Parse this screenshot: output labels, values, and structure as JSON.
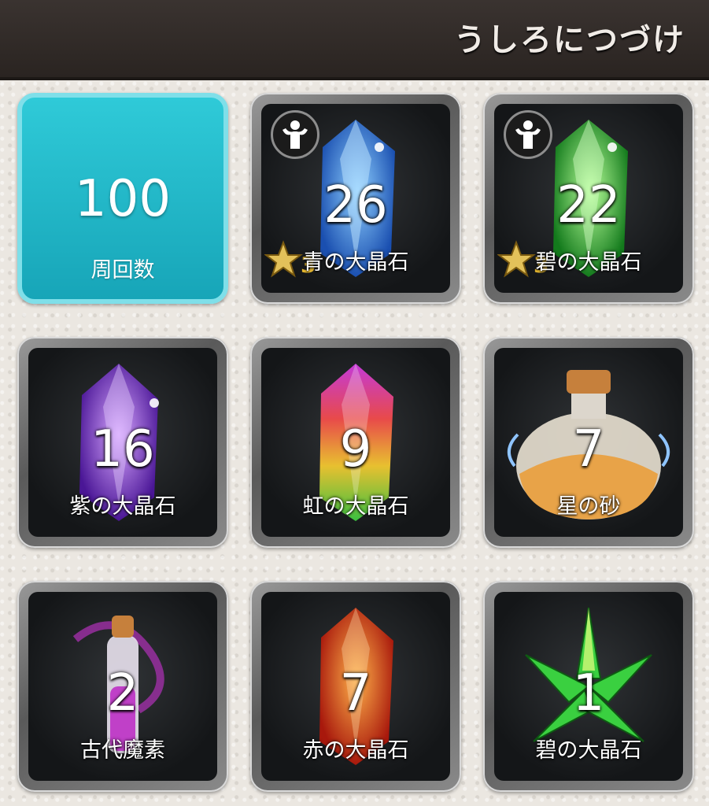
{
  "header": {
    "title": "うしろにつづけ"
  },
  "summary": {
    "count": "100",
    "label": "周回数"
  },
  "items": [
    {
      "count": "26",
      "label": "青の大晶石",
      "icon": "blue-crystal-icon",
      "color": "#2f7ad8",
      "strength_badge": true,
      "star_rank": "3"
    },
    {
      "count": "22",
      "label": "碧の大晶石",
      "icon": "green-crystal-icon",
      "color": "#2fbf3a",
      "strength_badge": true,
      "star_rank": "3"
    },
    {
      "count": "16",
      "label": "紫の大晶石",
      "icon": "purple-crystal-icon",
      "color": "#8a3ad8"
    },
    {
      "count": "9",
      "label": "虹の大晶石",
      "icon": "rainbow-crystal-icon",
      "color": "#d84ab0"
    },
    {
      "count": "7",
      "label": "星の砂",
      "icon": "star-sand-bottle-icon",
      "color": "#e0a050"
    },
    {
      "count": "2",
      "label": "古代魔素",
      "icon": "ancient-essence-vial-icon",
      "color": "#c040c8"
    },
    {
      "count": "7",
      "label": "赤の大晶石",
      "icon": "red-crystal-icon",
      "color": "#e04a20"
    },
    {
      "count": "1",
      "label": "碧の大晶石",
      "icon": "green-crystal-cluster-icon",
      "color": "#3ad040"
    }
  ]
}
